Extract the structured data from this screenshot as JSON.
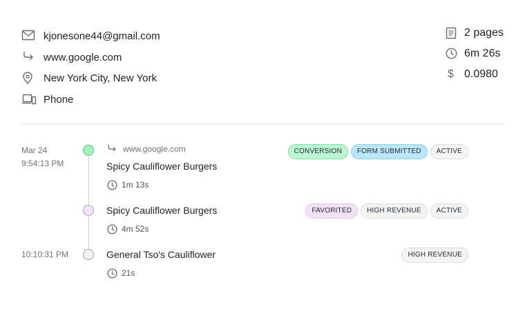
{
  "visitor": {
    "email": "kjonesone44@gmail.com",
    "referrer": "www.google.com",
    "location": "New York City, New York",
    "device": "Phone"
  },
  "stats": {
    "pages": "2 pages",
    "duration": "6m 26s",
    "revenue": "0.0980"
  },
  "timeline": [
    {
      "date": "Mar 24",
      "time": "9:54:13 PM",
      "referrer": "www.google.com",
      "title": "Spicy Cauliflower Burgers",
      "duration": "1m 13s",
      "dot_color": "#a7f3c0",
      "badges": [
        "CONVERSION",
        "FORM SUBMITTED",
        "ACTIVE"
      ]
    },
    {
      "title": "Spicy Cauliflower Burgers",
      "duration": "4m 52s",
      "dot_color": "#f3e3f7",
      "badges": [
        "FAVORITED",
        "HIGH REVENUE",
        "ACTIVE"
      ]
    },
    {
      "time": "10:10:31 PM",
      "title": "General Tso's Cauliflower",
      "duration": "21s",
      "dot_color": "#f1f1f2",
      "badges": [
        "HIGH REVENUE"
      ]
    }
  ],
  "badge_colors": {
    "conversion": "#bbf7d0",
    "form_submitted": "#bae6fd",
    "favorited": "#f5e1f7",
    "neutral": "#f4f4f5"
  }
}
